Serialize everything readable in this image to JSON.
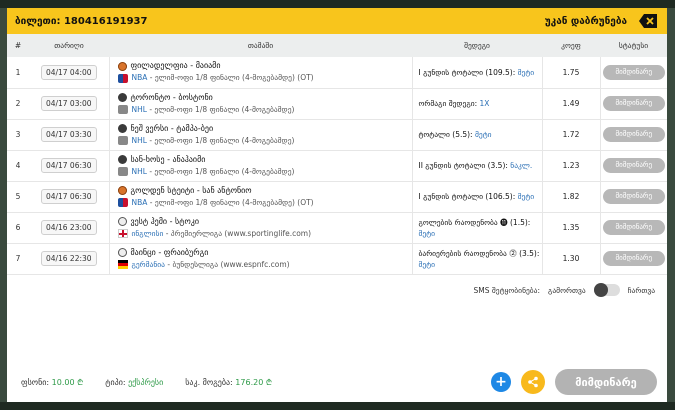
{
  "header": {
    "ticket_label": "ბილეთი: 180416191937",
    "back_label": "უკან დაბრუნება"
  },
  "columns": [
    "#",
    "თარიღი",
    "თამაში",
    "შედეგი",
    "კოეფ",
    "სტატუსი"
  ],
  "rows": [
    {
      "num": "1",
      "date": "04/17 04:00",
      "title": "ფილადელფია - მაიამი",
      "league": "NBA",
      "sub": " - ელიმ-ოფი 1/8 ფინალი (4-მოგებამდე) (OT)",
      "sport": "basketball-icon",
      "flag": "nba-flag-icon",
      "market": "I გუნდის ტოტალი (109.5):",
      "pick": "მეტი",
      "odds": "1.75",
      "status": "მიმდინარე"
    },
    {
      "num": "2",
      "date": "04/17 03:00",
      "title": "ტორონტო - ბოსტონი",
      "league": "NHL",
      "sub": " - ელიმ-ოფი 1/8 ფინალი (4-მოგებამდე)",
      "sport": "hockey-puck-icon",
      "flag": "nhl-flag-icon",
      "market": "ორმაგი შედეგი:",
      "pick": "1X",
      "odds": "1.49",
      "status": "მიმდინარე"
    },
    {
      "num": "3",
      "date": "04/17 03:30",
      "title": "ნეშ ვერსი - ტამპა-ბეი",
      "league": "NHL",
      "sub": " - ელიმ-ოფი 1/8 ფინალი (4-მოგებამდე)",
      "sport": "hockey-puck-icon",
      "flag": "nhl-flag-icon",
      "market": "ტოტალი (5.5):",
      "pick": "მეტი",
      "odds": "1.72",
      "status": "მიმდინარე"
    },
    {
      "num": "4",
      "date": "04/17 06:30",
      "title": "სან-ხოსე - ანაჰაიმი",
      "league": "NHL",
      "sub": " - ელიმ-ოფი 1/8 ფინალი (4-მოგებამდე)",
      "sport": "hockey-puck-icon",
      "flag": "nhl-flag-icon",
      "market": "II გუნდის ტოტალი (3.5):",
      "pick": "ნაკლ.",
      "odds": "1.23",
      "status": "მიმდინარე"
    },
    {
      "num": "5",
      "date": "04/17 06:30",
      "title": "გოლდენ სტეიტი - სან ანტონიო",
      "league": "NBA",
      "sub": " - ელიმ-ოფი 1/8 ფინალი (4-მოგებამდე) (OT)",
      "sport": "basketball-icon",
      "flag": "nba-flag-icon",
      "market": "I გუნდის ტოტალი (106.5):",
      "pick": "მეტი",
      "odds": "1.82",
      "status": "მიმდინარე"
    },
    {
      "num": "6",
      "date": "04/16 23:00",
      "title": "ვესტ ჰემი - სტოკი",
      "league": "ინგლისი",
      "sub": " - პრემიერლიგა (www.sportinglife.com)",
      "sport": "soccer-ball-icon",
      "flag": "england-flag-icon",
      "market": "გოლების რაოდენობა ⓫ (1.5):",
      "pick": "მეტი",
      "odds": "1.35",
      "status": "მიმდინარე"
    },
    {
      "num": "7",
      "date": "04/16 22:30",
      "title": "მაინცი - ფრაიბურგი",
      "league": "გერმანია",
      "sub": " - ბუნდესლიგა (www.espnfc.com)",
      "sport": "soccer-ball-icon",
      "flag": "germany-flag-icon",
      "market": "ბარიერების რაოდენობა ⓶ (3.5):",
      "pick": "მეტი",
      "odds": "1.30",
      "status": "მიმდინარე"
    }
  ],
  "sms": {
    "label": "SMS შეტყობინება:",
    "off_label": "გამორთვა",
    "on_label": "ჩართვა"
  },
  "footer": {
    "stake_label": "ფსონი:",
    "stake_value": "10.00 ₾",
    "type_label": "ტიპი:",
    "type_value": "ექსპრესი",
    "win_label": "საკ. მოგება:",
    "win_value": "176.20 ₾",
    "current_button": "მიმდინარე"
  },
  "colors": {
    "header_bg": "#f8c51c",
    "link_blue": "#2a6fb5",
    "money_green": "#2e9a48",
    "status_gray": "#b8b8b8"
  }
}
